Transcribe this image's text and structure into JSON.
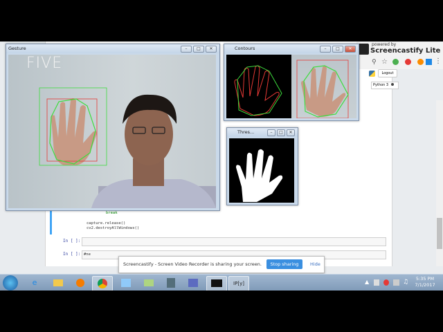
{
  "gesture_window": {
    "title": "Gesture",
    "gesture_label": "FIVE"
  },
  "contours_window": {
    "title": "Contours"
  },
  "threshold_window": {
    "title": "Thres..."
  },
  "notebook": {
    "code_break": "break",
    "code_lines": [
      "capture.release()",
      "cv2.destroyAllWindows()"
    ],
    "prompt_1": "In [ ]:",
    "prompt_2": "In [ ]:",
    "cell_2_text": "#ne",
    "logout_label": "Logout",
    "kernel_label": "Python 3"
  },
  "screencastify": {
    "powered_by": "powered by",
    "brand": "Screencastify Lite",
    "share_message": "Screencastify - Screen Video Recorder is sharing your screen.",
    "stop_button": "Stop sharing",
    "hide_link": "Hide"
  },
  "taskbar": {
    "time": "5:35 PM",
    "date": "7/1/2017",
    "ipy_label": "IP[y]"
  },
  "colors": {
    "contour_red": "#e53935",
    "hull_green": "#3ddc3d",
    "accent_blue": "#3a8fe0"
  }
}
